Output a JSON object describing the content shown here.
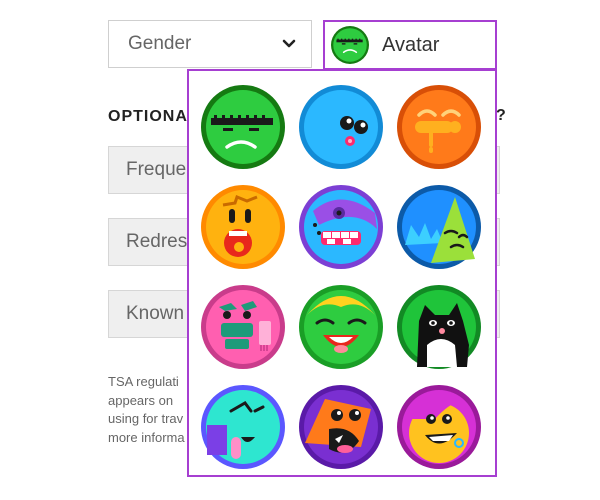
{
  "gender_select": {
    "label": "Gender",
    "icon": "chevron-down-icon"
  },
  "avatar_select": {
    "label": "Avatar",
    "selected": "green-frankenstein"
  },
  "optional_section": {
    "title": "OPTIONAL INFORMATION",
    "title_visible": "OPTIONA",
    "trailing_char": "?"
  },
  "fields": [
    {
      "label": "Frequent",
      "visible": "Freque"
    },
    {
      "label": "Redress",
      "visible": "Redres"
    },
    {
      "label": "Known",
      "visible": "Known"
    }
  ],
  "footnote_lines": [
    "TSA regulati",
    "appears on",
    "using for trav",
    "more informa"
  ],
  "avatar_grid": [
    {
      "name": "green-frankenstein",
      "bg": "#2ecc40",
      "ring": "#157a12"
    },
    {
      "name": "blue-googly",
      "bg": "#2bb8ff",
      "ring": "#128bd6"
    },
    {
      "name": "orange-drool",
      "bg": "#ff7a1a",
      "ring": "#d84f07"
    },
    {
      "name": "yellow-shout",
      "bg": "#ffb20f",
      "ring": "#ff8a00"
    },
    {
      "name": "blue-purple-teeth",
      "bg": "#2bb8ff",
      "ring": "#7c3fd4"
    },
    {
      "name": "blue-green-shy",
      "bg": "#1f90ff",
      "ring": "#0c5aa8"
    },
    {
      "name": "pink-mustache",
      "bg": "#ff5fb0",
      "ring": "#c93c8b"
    },
    {
      "name": "green-pigtails",
      "bg": "#2ecc40",
      "ring": "#1a9e26"
    },
    {
      "name": "black-cat",
      "bg": "#1fc43a",
      "ring": "#128a24"
    },
    {
      "name": "teal-purple-tongue",
      "bg": "#2ee6d0",
      "ring": "#5b57ff"
    },
    {
      "name": "purple-orange-bird",
      "bg": "#7a2fd1",
      "ring": "#5a1aa8"
    },
    {
      "name": "magenta-yellow-girl",
      "bg": "#d630d6",
      "ring": "#9a1a9a"
    }
  ],
  "accent": "#a63fd1"
}
